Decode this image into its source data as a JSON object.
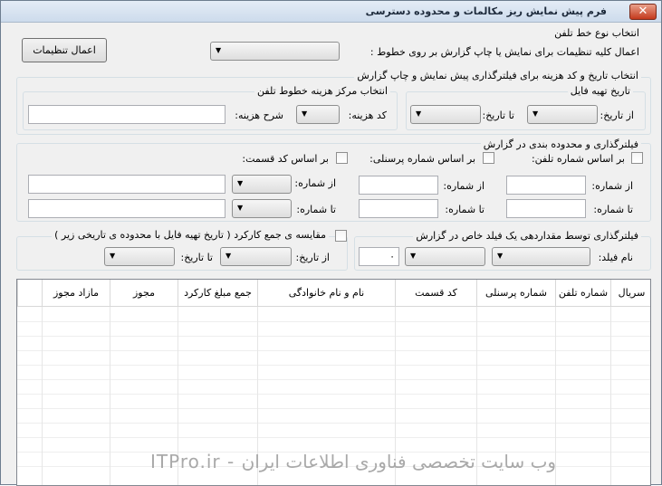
{
  "window": {
    "title": "فرم پیش نمایش ریز مکالمات و محدوده دسترسی",
    "close_glyph": "✕"
  },
  "line_type": {
    "group_title": "انتخاب نوع خط تلفن",
    "apply_label": "اعمال کلیه تنظیمات برای نمایش یا چاپ گزارش بر روی خطوط :",
    "apply_button": "اعمال تنظیمات"
  },
  "date_code": {
    "group_title": "انتخاب تاریخ و کد هزینه برای فیلترگذاری پیش نمایش و چاپ گزارش",
    "file_date": {
      "title": "تاریخ تهیه فایل",
      "from_label": "از تاریخ:",
      "to_label": "تا تاریخ:"
    },
    "cost_center": {
      "title": "انتخاب مرکز هزینه خطوط تلفن",
      "code_label": "کد هزینه:",
      "desc_label": "شرح هزینه:"
    }
  },
  "filter": {
    "group_title": "فیلترگذاری و محدوده بندی در گزارش",
    "by_phone": "بر اساس شماره تلفن:",
    "by_personnel": "بر اساس شماره پرسنلی:",
    "by_section": "بر اساس کد قسمت:",
    "from_number": "از شماره:",
    "to_number": "تا شماره:"
  },
  "field_filter": {
    "group_title": "فیلترگذاری توسط مقداردهی یک فیلد خاص در گزارش",
    "field_label": "نام فیلد:",
    "value": "۰"
  },
  "compare": {
    "group_title": "مقایسه ی جمع کارکرد ( تاریخ تهیه فایل با محدوده ی تاریخی زیر )",
    "from_label": "از تاریخ:",
    "to_label": "تا تاریخ:"
  },
  "grid": {
    "columns": [
      "سریال",
      "شماره تلفن",
      "شماره پرسنلی",
      "کد قسمت",
      "نام و نام خانوادگی",
      "جمع مبلغ کارکرد",
      "مجوز",
      "مازاد مجوز"
    ]
  },
  "watermark": "ITPro.ir - وب سایت تخصصی فناوری اطلاعات ایران",
  "icons": {
    "dropdown": "▼"
  }
}
